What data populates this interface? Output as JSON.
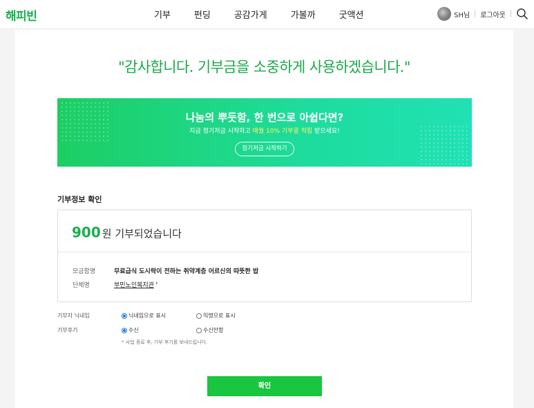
{
  "header": {
    "logo": "해피빈",
    "nav": [
      "기부",
      "펀딩",
      "공감가게",
      "가볼까",
      "굿액션"
    ],
    "user_name": "SH님",
    "logout": "로그아웃",
    "search_icon": "search-icon"
  },
  "thanks_message": "\"감사합니다. 기부금을 소중하게 사용하겠습니다.\"",
  "banner": {
    "title": "나눔의 뿌듯함, 한 번으로 아쉽다면?",
    "sub_prefix": "지금 정기저금 시작하고 ",
    "sub_highlight": "매월 10% 기부콩 적립",
    "sub_suffix": " 받으세요!",
    "button": "정기저금 시작하기",
    "color_start": "#1dce63",
    "color_end": "#20e1b4"
  },
  "donation_info": {
    "section_title": "기부정보 확인",
    "amount": "900",
    "amount_text": "원 기부되었습니다",
    "rows": [
      {
        "label": "모금함명",
        "value": "무료급식 도시락이 전하는 취약계층 어르신의 따뜻한 밥"
      },
      {
        "label": "단체명",
        "value": "부민노인복지관"
      }
    ]
  },
  "options": [
    {
      "label": "기부자 닉네임",
      "choices": [
        "닉네임으로 표시",
        "익명으로 표시"
      ],
      "selected": 0
    },
    {
      "label": "기부후기",
      "choices": [
        "수신",
        "수신안함"
      ],
      "selected": 0
    }
  ],
  "note": "* 사업 종료 후, 기부 후기를 보내드립니다.",
  "confirm_button": "확인",
  "accent_color": "#16b14b"
}
